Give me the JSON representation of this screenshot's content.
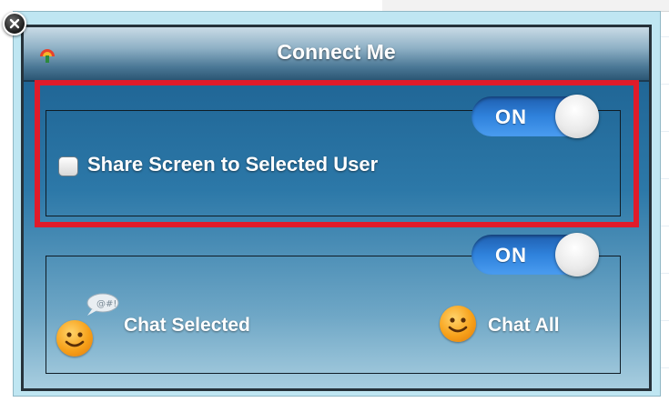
{
  "dialog": {
    "title": "Connect Me"
  },
  "share_section": {
    "toggle_label": "ON",
    "checkbox_label": "Share Screen to Selected User",
    "checked": false
  },
  "chat_section": {
    "toggle_label": "ON",
    "chat_selected_label": "Chat Selected",
    "chat_all_label": "Chat All"
  },
  "icons": {
    "close": "close-icon",
    "app": "app-logo-icon",
    "chat_selected": "smiley-with-speech-bubble-icon",
    "chat_all": "smiley-icon"
  },
  "colors": {
    "highlight": "#e01b2a",
    "toggle_on": "#2f82dc",
    "panel_top": "#1a5d8d",
    "panel_bottom": "#a7cddf"
  }
}
